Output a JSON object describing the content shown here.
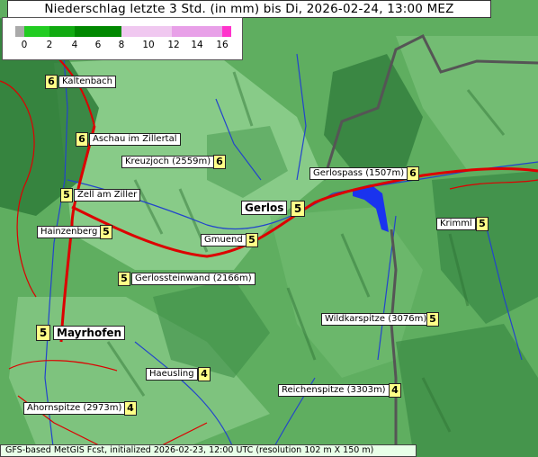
{
  "title": "Niederschlag letzte 3 Std. (in mm) bis Di, 2026-02-24, 13:00 MEZ",
  "legend": {
    "ticks": [
      "0",
      "2",
      "4",
      "6",
      "8",
      "10",
      "12",
      "14",
      "16"
    ],
    "colors": {
      "zero": "#aaaaaa",
      "band1": "#22cc22",
      "band2": "#11aa11",
      "band3": "#008800",
      "band4": "#f0c8f0",
      "band5": "#e8a0e8",
      "max": "#ff33cc"
    }
  },
  "places": [
    {
      "name": "Kaltenbach",
      "value": "6"
    },
    {
      "name": "Aschau im Zillertal",
      "value": "6"
    },
    {
      "name": "Kreuzjoch (2559m)",
      "value": "6"
    },
    {
      "name": "Gerlospass (1507m)",
      "value": "6"
    },
    {
      "name": "Zell am Ziller",
      "value": "5"
    },
    {
      "name": "Gerlos",
      "value": "5"
    },
    {
      "name": "Krimml",
      "value": "5"
    },
    {
      "name": "Hainzenberg",
      "value": "5"
    },
    {
      "name": "Gmuend",
      "value": "5"
    },
    {
      "name": "Gerlossteinwand (2166m)",
      "value": "5"
    },
    {
      "name": "Wildkarspitze (3076m)",
      "value": "5"
    },
    {
      "name": "Mayrhofen",
      "value": "5"
    },
    {
      "name": "Haeusling",
      "value": "4"
    },
    {
      "name": "Reichenspitze (3303m)",
      "value": "4"
    },
    {
      "name": "Ahornspitze (2973m)",
      "value": "4"
    }
  ],
  "footer": "GFS-based MetGIS Fcst, initialized 2026-02-23, 12:00 UTC  (resolution 102 m X 150 m)",
  "colors": {
    "terrain_light": "#8fd08f",
    "terrain_mid": "#5fb05f",
    "terrain_dark": "#2e7d3a",
    "road": "#dd0000",
    "border": "#555555",
    "river": "#2244cc",
    "lake": "#1a33ee"
  }
}
